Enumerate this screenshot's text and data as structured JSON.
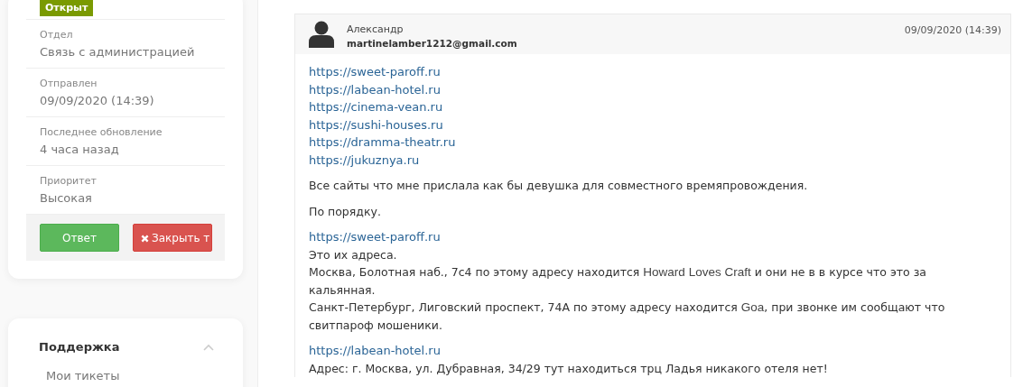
{
  "sidebar": {
    "status_badge": "Открыт",
    "fields": [
      {
        "label": "Отдел",
        "value": "Связь с администрацией"
      },
      {
        "label": "Отправлен",
        "value": "09/09/2020 (14:39)"
      },
      {
        "label": "Последнее обновление",
        "value": "4 часа назад"
      },
      {
        "label": "Приоритет",
        "value": "Высокая"
      }
    ],
    "buttons": [
      {
        "kind": "reply",
        "label": "Ответ"
      },
      {
        "kind": "close",
        "label": "Закрыть т"
      }
    ]
  },
  "support_menu": {
    "title": "Поддержка",
    "expanded": true,
    "items": [
      "Мои тикеты"
    ]
  },
  "message": {
    "author": "Александр",
    "email": "martinelamber1212@gmail.com",
    "date": "09/09/2020 (14:39)",
    "paragraphs": [
      [
        [
          {
            "kind": "link",
            "text": "https://sweet-paroff.ru"
          }
        ],
        [
          {
            "kind": "link",
            "text": "https://labean-hotel.ru"
          }
        ],
        [
          {
            "kind": "link",
            "text": "https://cinema-vean.ru"
          }
        ],
        [
          {
            "kind": "link",
            "text": "https://sushi-houses.ru"
          }
        ],
        [
          {
            "kind": "link",
            "text": "https://dramma-theatr.ru"
          }
        ],
        [
          {
            "kind": "link",
            "text": "https://jukuznya.ru"
          }
        ]
      ],
      [
        [
          {
            "kind": "text",
            "text": "Все сайты что мне прислала как бы девушка для совместного времяпровождения."
          }
        ]
      ],
      [
        [
          {
            "kind": "text",
            "text": "По порядку."
          }
        ]
      ],
      [
        [
          {
            "kind": "link",
            "text": "https://sweet-paroff.ru"
          }
        ],
        [
          {
            "kind": "text",
            "text": "Это их адреса."
          }
        ],
        [
          {
            "kind": "text",
            "text": "Москва, Болотная наб., 7с4 по этому адресу находится "
          },
          {
            "kind": "name",
            "text": "Howard Loves Craft"
          },
          {
            "kind": "text",
            "text": " и они не в в курсе что это за кальянная."
          }
        ],
        [
          {
            "kind": "text",
            "text": "Санкт-Петербург, Лиговский проспект, 74А по этому адресу находится "
          },
          {
            "kind": "name",
            "text": "Goa"
          },
          {
            "kind": "text",
            "text": ", при звонке им сообщают что свитпароф мошеники."
          }
        ]
      ],
      [
        [
          {
            "kind": "link",
            "text": "https://labean-hotel.ru"
          }
        ],
        [
          {
            "kind": "text",
            "text": "Адрес: г. Москва, ул. Дубравная, 34/29 тут находиться трц Ладья никакого отеля нет!"
          }
        ]
      ]
    ]
  }
}
